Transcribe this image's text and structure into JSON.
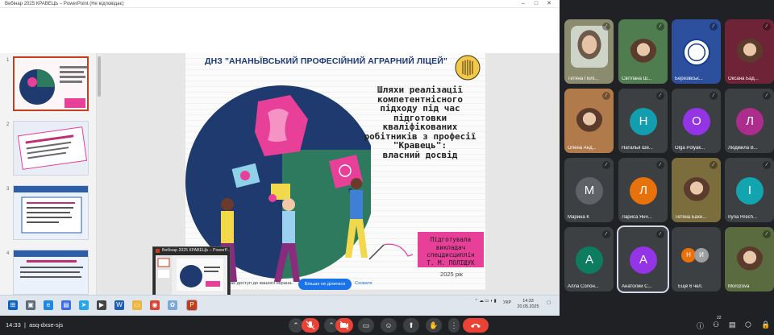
{
  "window": {
    "title": "Вебінар 2025 КРАВЕЦЬ – PowerPoint (Не відповідає)",
    "controls": [
      "–",
      "□",
      "✕"
    ]
  },
  "thumbnails": [
    {
      "num": "1",
      "selected": true
    },
    {
      "num": "2",
      "selected": false
    },
    {
      "num": "3",
      "selected": false
    },
    {
      "num": "4",
      "selected": false
    }
  ],
  "slide": {
    "header": "ДНЗ \"АНАНЬЇВСЬКИЙ ПРОФЕСІЙНИЙ АГРАРНИЙ ЛІЦЕЙ\"",
    "title_lines": [
      "Шляхи реалізації",
      "компетентнісного",
      "підходу під час",
      "підготовки",
      "кваліфікованих",
      "робітників з професії",
      "\"Кравець\":",
      "власний досвід"
    ],
    "badge_lines": [
      "Підготувала",
      "викладач",
      "спецдисциплін",
      "Т. М. ПОЛІЩУК"
    ],
    "year": "2025 рік"
  },
  "notification": {
    "text": "має доступ до вашого екрана.",
    "stop_label": "Більше не ділитися",
    "hide_label": "Сховати"
  },
  "popup": {
    "title": "Вебінар 2025 КРАВЕЦЬ – PowerP..."
  },
  "taskbar": {
    "lang": "УКР",
    "time": "14:33",
    "date": "20.05.2025"
  },
  "participants": [
    {
      "name": "Тетяна Полі...",
      "initial": "",
      "color": "#8b8b6e",
      "type": "video"
    },
    {
      "name": "Світлана Ш...",
      "initial": "",
      "color": "#4f7d4f",
      "type": "photo"
    },
    {
      "name": "Березівськ...",
      "initial": "",
      "color": "#2c4f9e",
      "type": "logo"
    },
    {
      "name": "Оксана Бад...",
      "initial": "",
      "color": "#6e2436",
      "type": "photo"
    },
    {
      "name": "Олена Анд...",
      "initial": "",
      "color": "#b07a4a",
      "type": "photo"
    },
    {
      "name": "Наталья Ше...",
      "initial": "Н",
      "color": "#129eaf",
      "type": "letter"
    },
    {
      "name": "Olga Polyak...",
      "initial": "O",
      "color": "#9334e6",
      "type": "letter"
    },
    {
      "name": "Людмила В...",
      "initial": "Л",
      "color": "#ad2d8c",
      "type": "letter"
    },
    {
      "name": "Марина К",
      "initial": "М",
      "color": "#5f6368",
      "type": "letter"
    },
    {
      "name": "Лариса Янч...",
      "initial": "Л",
      "color": "#e8710a",
      "type": "letter"
    },
    {
      "name": "Тетяна Бахн...",
      "initial": "",
      "color": "#7b6d3c",
      "type": "photo"
    },
    {
      "name": "Iryna Hrech...",
      "initial": "I",
      "color": "#12a4af",
      "type": "letter"
    },
    {
      "name": "Алла Солон...",
      "initial": "А",
      "color": "#0d7c5f",
      "type": "letter"
    },
    {
      "name": "Анатолий С...",
      "initial": "А",
      "color": "#9334e6",
      "type": "letter"
    },
    {
      "name": "Ещё 6 чел.",
      "initial": "",
      "color": "#3c4043",
      "type": "more"
    },
    {
      "name": "Morozova",
      "initial": "",
      "color": "#5a6b40",
      "type": "photo"
    }
  ],
  "more_avatars": [
    "Н",
    "И"
  ],
  "meeting": {
    "time": "14:33",
    "code": "asq-dxse-sjs",
    "participant_count": "22"
  },
  "colors": {
    "leave": "#ea4335",
    "meet_bg": "#202124",
    "slide_pink": "#e83f98",
    "slide_navy": "#1f3a7a"
  }
}
